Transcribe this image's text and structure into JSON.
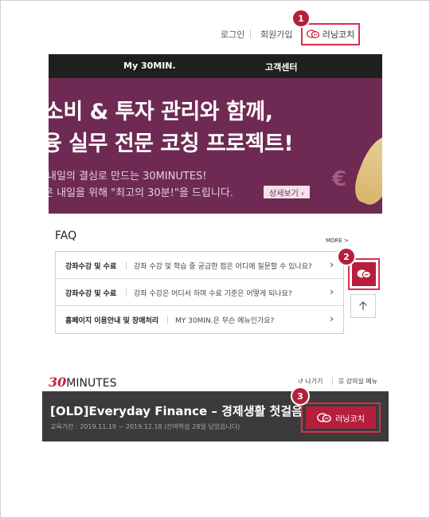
{
  "top_nav": {
    "login": "로그인",
    "signup": "회원가입",
    "running_coach": "러닝코치"
  },
  "markers": [
    "1",
    "2",
    "3"
  ],
  "menu": {
    "my_30min": "My 30MIN.",
    "customer_center": "고객센터"
  },
  "banner": {
    "headline_1": "소비 & 투자 관리와 함께,",
    "headline_2": "융 실무 전문 코칭 프로젝트!",
    "sub_1": "내일의 결심로 만드는 30MINUTES!",
    "sub_2": "은 내일을 위해 \"최고의 30분!\"을 드립니다.",
    "detail_button": "상세보기 ›",
    "euro_symbol": "€"
  },
  "faq": {
    "title": "FAQ",
    "more": "MORE >",
    "items": [
      {
        "category": "강좌수강 및 수료",
        "question": "강좌 수강 및 학습 중 궁금한 점은 어디에 질문할 수 있나요?"
      },
      {
        "category": "강좌수강 및 수료",
        "question": "강좌 수강은 어디서 하며 수료 기준은 어떻게 되나요?"
      },
      {
        "category": "홈페이지 이용안내 및 장애처리",
        "question": "MY 30MIN.은 무슨 메뉴인가요?"
      }
    ]
  },
  "course_header": {
    "logo_number": "30",
    "logo_text": "MINUTES",
    "back": "나가기",
    "classroom_menu": "강의실 메뉴"
  },
  "course": {
    "title": "[OLD]Everyday Finance – 경제생활 첫걸음!",
    "period": "교육기간 : 2019.11.19 ~ 2019.12.18 (잔여학습 28일 남았습니다)",
    "coach_button": "러닝코치"
  },
  "colors": {
    "accent": "#d8314c",
    "coach_red": "#b51f3c",
    "banner_bg": "#6e2a52",
    "menu_bg": "#1f1f1f",
    "course_bg": "#3b3b3b"
  }
}
